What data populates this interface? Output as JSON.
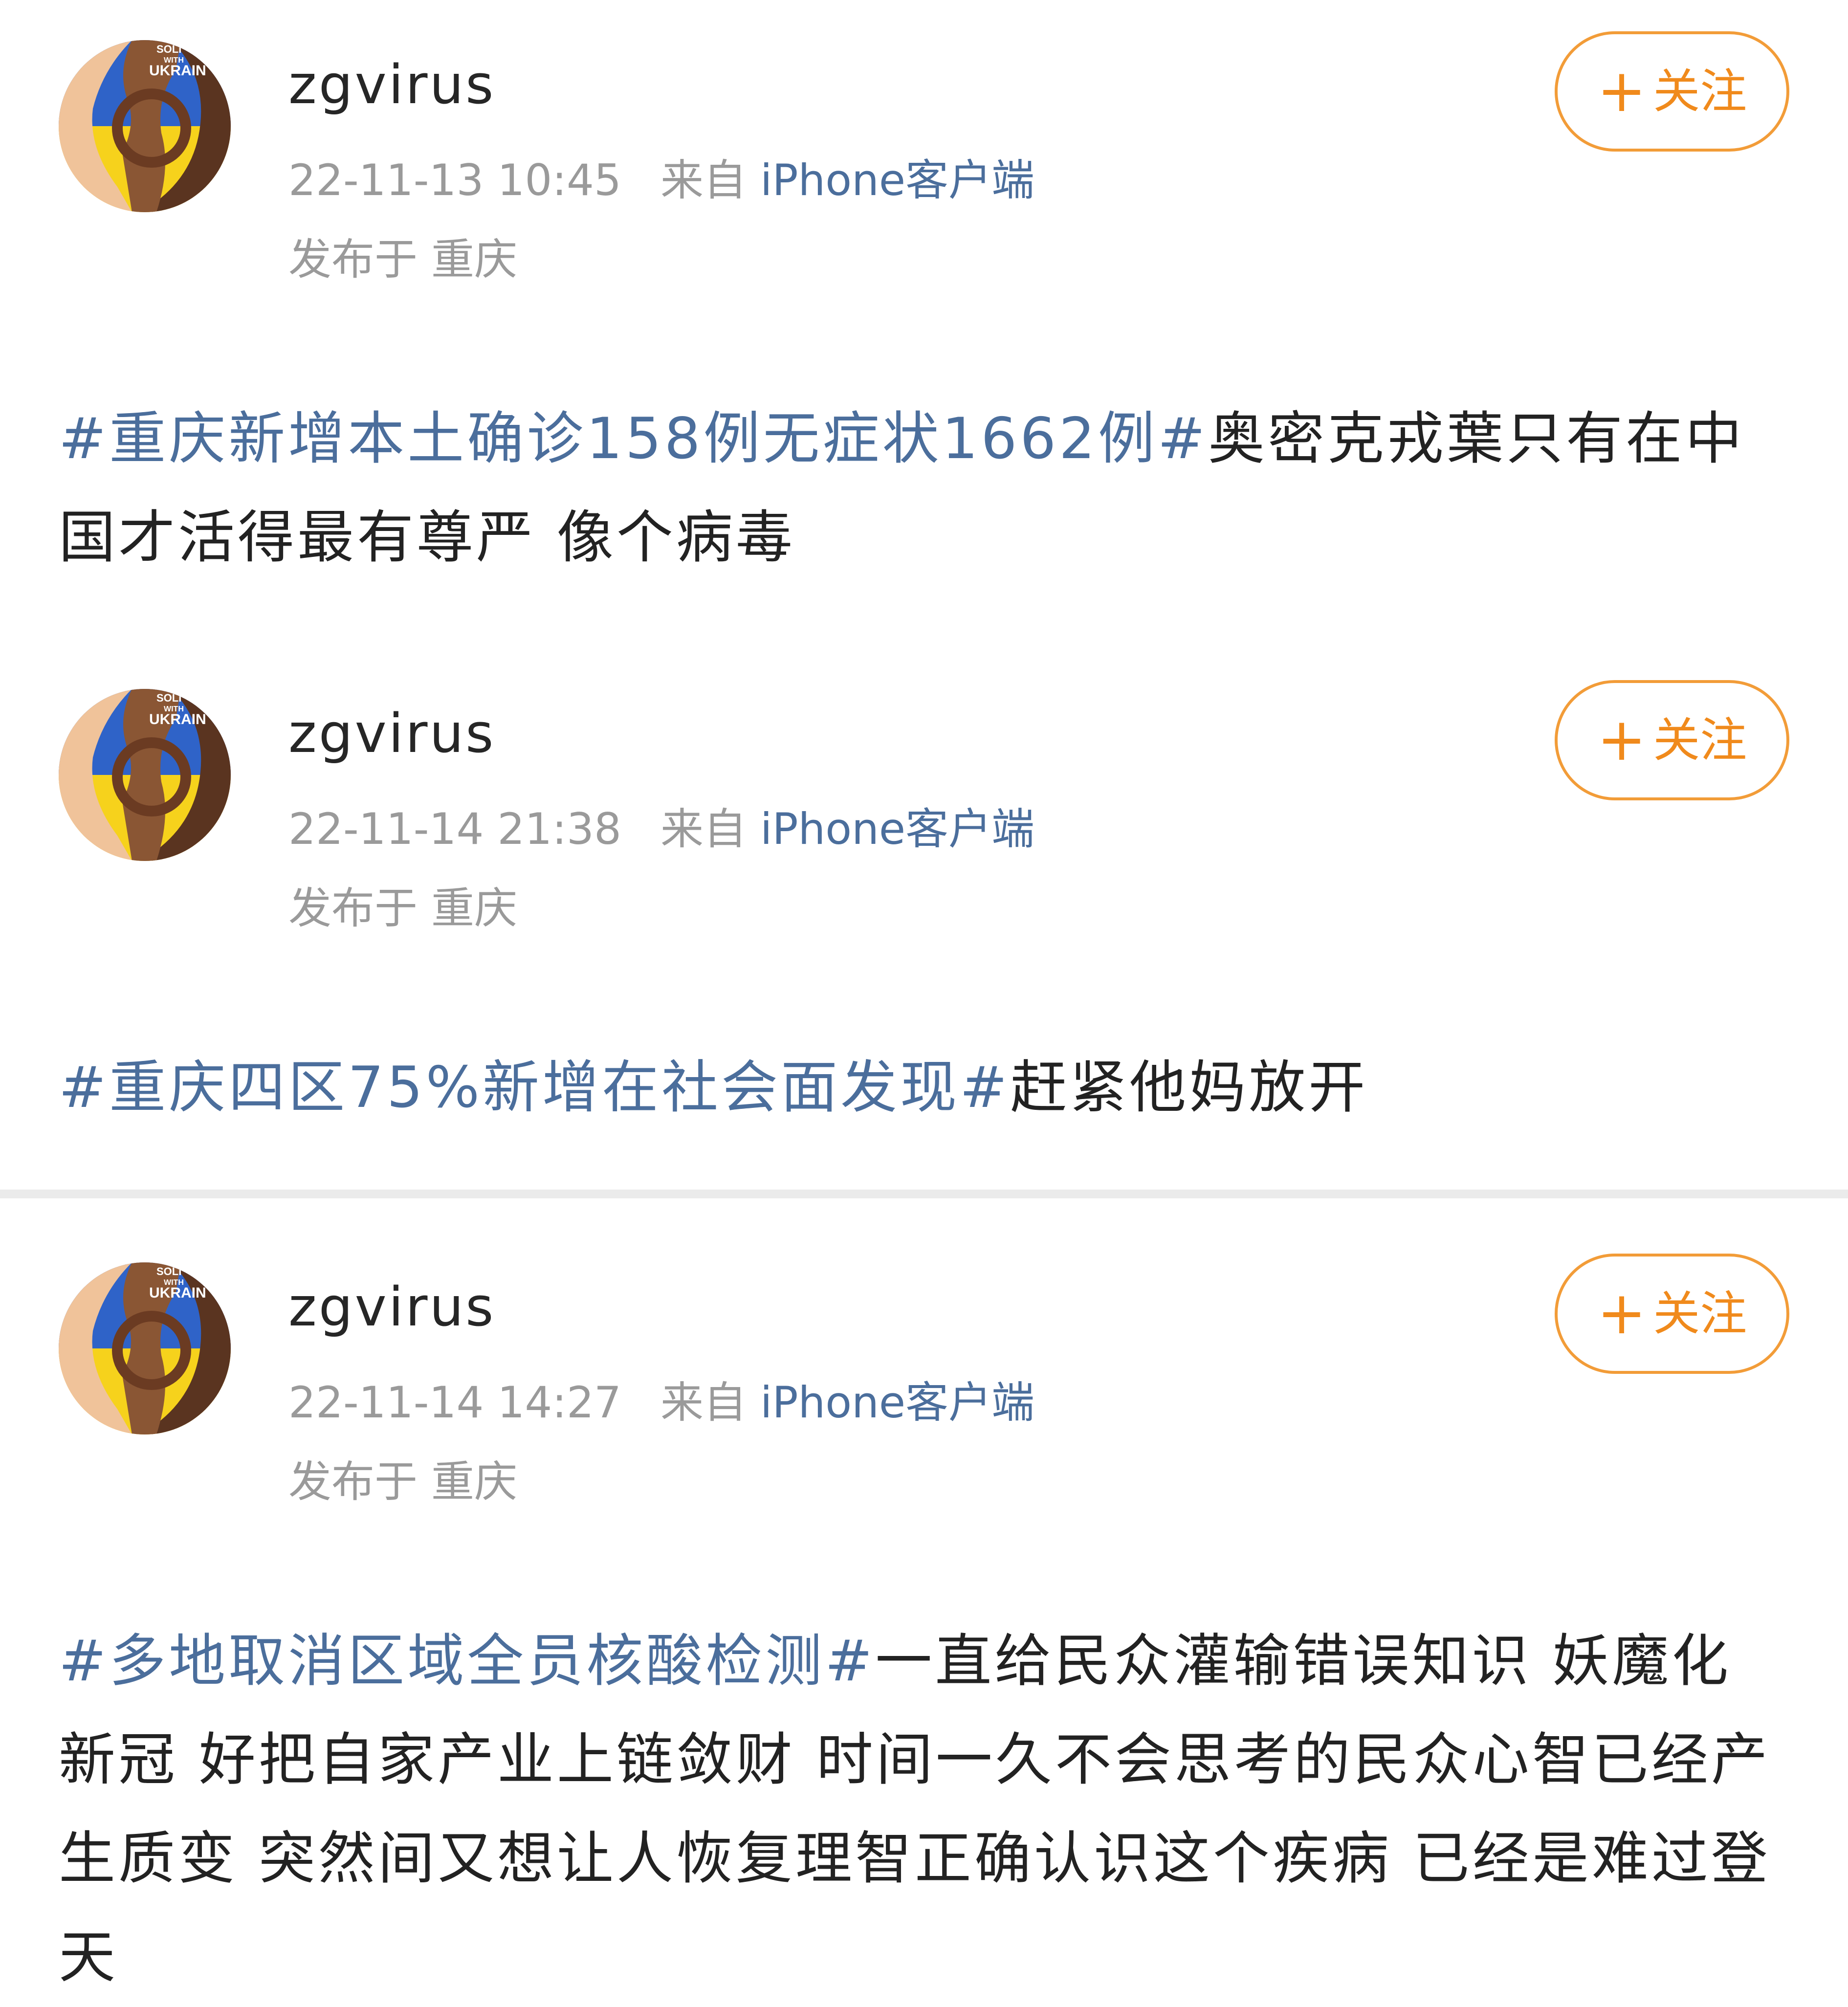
{
  "colors": {
    "hashtag": "#4b6e9c",
    "source_app": "#4b6e9c",
    "follow_accent": "#f08a1c",
    "meta_text": "#9a9a9a",
    "divider": "#ebebeb"
  },
  "avatar": {
    "icon": "solidarity-with-ukraine-avatar",
    "text_line1": "SOLI",
    "text_line2": "WITH",
    "text_line3": "UKRAIN"
  },
  "posts": [
    {
      "username": "zgvirus",
      "timestamp": "22-11-13 10:45",
      "source_prefix": "来自",
      "source_app": "iPhone客户端",
      "location": "发布于 重庆",
      "follow_label": "关注",
      "follow_icon": "plus-icon",
      "hashtag": "#重庆新增本土确诊158例无症状1662例#",
      "body": "奥密克戎葉只有在中国才活得最有尊严 像个病毒"
    },
    {
      "username": "zgvirus",
      "timestamp": "22-11-14 21:38",
      "source_prefix": "来自",
      "source_app": "iPhone客户端",
      "location": "发布于 重庆",
      "follow_label": "关注",
      "follow_icon": "plus-icon",
      "hashtag": "#重庆四区75%新增在社会面发现#",
      "body": "赶紧他妈放开"
    },
    {
      "username": "zgvirus",
      "timestamp": "22-11-14 14:27",
      "source_prefix": "来自",
      "source_app": "iPhone客户端",
      "location": "发布于 重庆",
      "follow_label": "关注",
      "follow_icon": "plus-icon",
      "hashtag": "#多地取消区域全员核酸检测#",
      "body": "一直给民众灌输错误知识 妖魔化新冠 好把自家产业上链敛财 时间一久不会思考的民众心智已经产生质变  突然间又想让人恢复理智正确认识这个疾病 已经是难过登天"
    }
  ]
}
